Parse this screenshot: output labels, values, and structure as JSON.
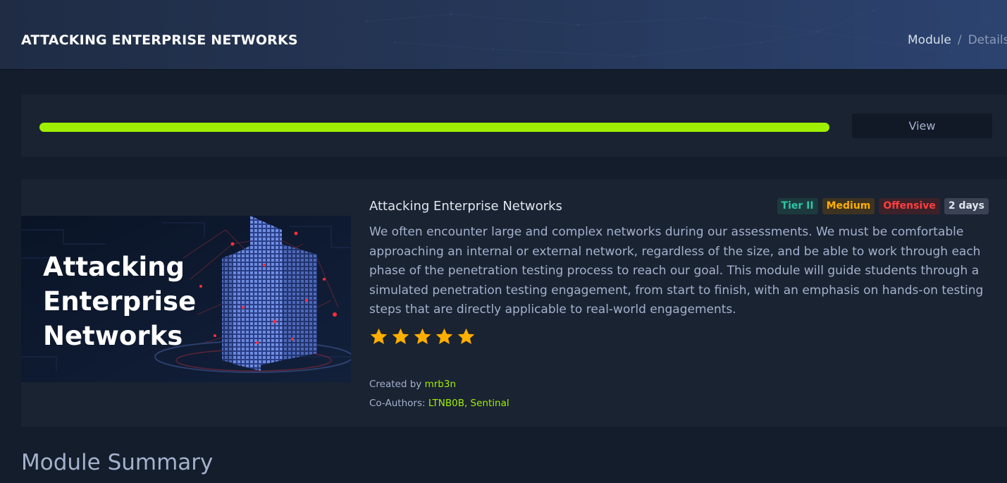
{
  "header": {
    "title": "ATTACKING ENTERPRISE NETWORKS",
    "breadcrumb": {
      "module": "Module",
      "separator": "/",
      "details": "Details"
    }
  },
  "progress": {
    "percent": 100,
    "color": "#9fef00",
    "view_label": "View"
  },
  "module": {
    "cover": {
      "line1": "Attacking",
      "line2": "Enterprise",
      "line3": "Networks"
    },
    "title": "Attacking Enterprise Networks",
    "tags": {
      "tier": "Tier II",
      "difficulty": "Medium",
      "type": "Offensive",
      "duration": "2 days"
    },
    "description": "We often encounter large and complex networks during our assessments. We must be comfortable approaching an internal or external network, regardless of the size, and be able to work through each phase of the penetration testing process to reach our goal. This module will guide students through a simulated penetration testing engagement, from start to finish, with an emphasis on hands-on testing steps that are directly applicable to real-world engagements.",
    "rating": 5,
    "created_by_label": "Created by",
    "created_by": "mrb3n",
    "coauthors_label": "Co-Authors:",
    "coauthors": "LTNB0B, Sentinal"
  },
  "summary": {
    "heading": "Module Summary"
  },
  "colors": {
    "accent": "#9fef00",
    "star": "#ffaf00",
    "background": "#141d2b",
    "panel": "#1a2332"
  }
}
